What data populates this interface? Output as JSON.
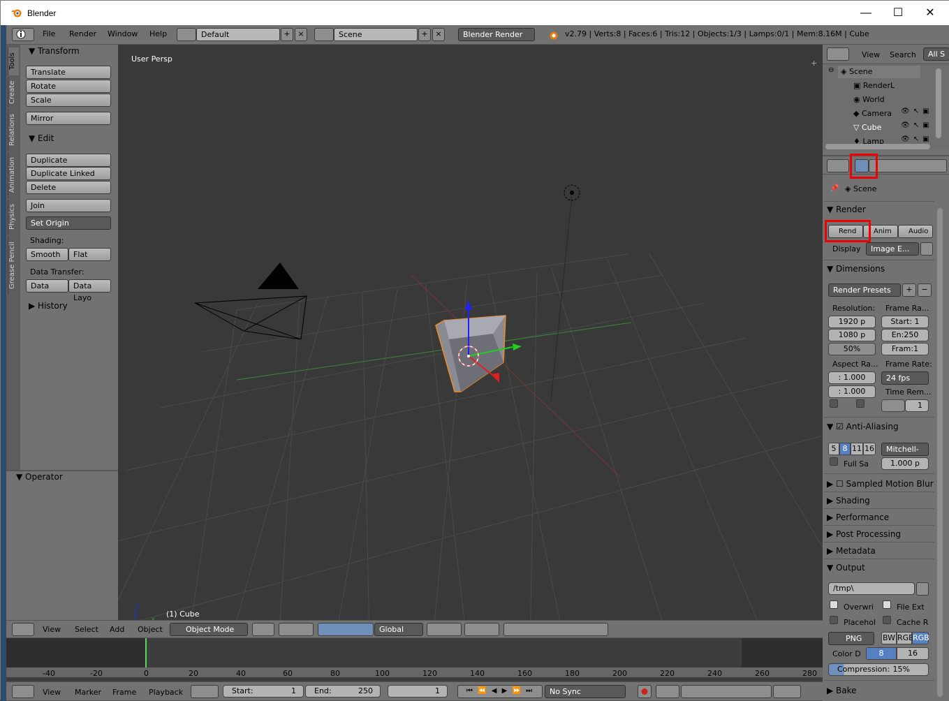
{
  "window": {
    "title": "Blender",
    "minimize": "—",
    "maximize": "☐",
    "close": "✕"
  },
  "info_header": {
    "menus": [
      "File",
      "Render",
      "Window",
      "Help"
    ],
    "screen_layout": "Default",
    "scene": "Scene",
    "engine": "Blender Render",
    "stats": "v2.79 | Verts:8 | Faces:6 | Tris:12 | Objects:1/3 | Lamps:0/1 | Mem:8.16M | Cube"
  },
  "tool_tabs": [
    "Tools",
    "Create",
    "Relations",
    "Animation",
    "Physics",
    "Grease Pencil"
  ],
  "tool_shelf": {
    "transform_title": "Transform",
    "transform_buttons": [
      "Translate",
      "Rotate",
      "Scale",
      "Mirror"
    ],
    "edit_title": "Edit",
    "edit_buttons": [
      "Duplicate",
      "Duplicate Linked",
      "Delete",
      "Join"
    ],
    "set_origin": "Set Origin",
    "shading_label": "Shading:",
    "smooth": "Smooth",
    "flat": "Flat",
    "data_transfer_label": "Data Transfer:",
    "data": "Data",
    "data_layo": "Data Layo",
    "history_title": "History",
    "operator_title": "Operator"
  },
  "viewport": {
    "view_label": "User Persp",
    "object_label": "(1) Cube"
  },
  "view3d_header": {
    "menus": [
      "View",
      "Select",
      "Add",
      "Object"
    ],
    "mode": "Object Mode",
    "orientation": "Global"
  },
  "timeline": {
    "ruler": [
      "-40",
      "-20",
      "0",
      "20",
      "40",
      "60",
      "80",
      "100",
      "120",
      "140",
      "160",
      "180",
      "200",
      "220",
      "240",
      "260",
      "280"
    ],
    "menus": [
      "View",
      "Marker",
      "Frame",
      "Playback"
    ],
    "start_label": "Start:",
    "start": "1",
    "end_label": "End:",
    "end": "250",
    "current": "1",
    "sync": "No Sync"
  },
  "outliner": {
    "menus": [
      "View",
      "Search"
    ],
    "filter": "All S",
    "items": [
      "Scene",
      "RenderL",
      "World",
      "Camera",
      "Cube",
      "Lamp"
    ]
  },
  "properties": {
    "context": "Scene",
    "render_title": "Render",
    "rend": "Rend",
    "anim": "Anim",
    "audio": "Audio",
    "display_label": "Display",
    "display_value": "Image E...",
    "dimensions_title": "Dimensions",
    "render_presets": "Render Presets",
    "resolution_label": "Resolution:",
    "frame_range_label": "Frame Ra...",
    "res_x": "1920 p",
    "res_y": "1080 p",
    "res_pct": "50%",
    "frame_start": "Start: 1",
    "frame_end": "En:250",
    "frame_step": "Fram:1",
    "aspect_label": "Aspect Ra...",
    "aspect_x": ": 1.000",
    "aspect_y": ": 1.000",
    "frame_rate_label": "Frame Rate:",
    "frame_rate": "24 fps",
    "time_remap_label": "Time Rem...",
    "time_remap": "1",
    "aa_title": "Anti-Aliasing",
    "aa_samples": [
      "5",
      "8",
      "11",
      "16"
    ],
    "aa_filter": "Mitchell-",
    "full_sample": "Full Sa",
    "filter_size": "1.000 p",
    "collapsed_panels": [
      "Sampled Motion Blur",
      "Shading",
      "Performance",
      "Post Processing",
      "Metadata"
    ],
    "output_title": "Output",
    "output_path": "/tmp\\",
    "overwrite": "Overwri",
    "file_ext": "File Ext",
    "placeholders": "Placehol",
    "cache_result": "Cache R",
    "format": "PNG",
    "color_modes": [
      "BW",
      "RGB",
      "RGB"
    ],
    "color_depth_label": "Color D",
    "depth_8": "8",
    "depth_16": "16",
    "compression": "Compression:",
    "compression_value": "15%",
    "bake_title": "Bake"
  }
}
